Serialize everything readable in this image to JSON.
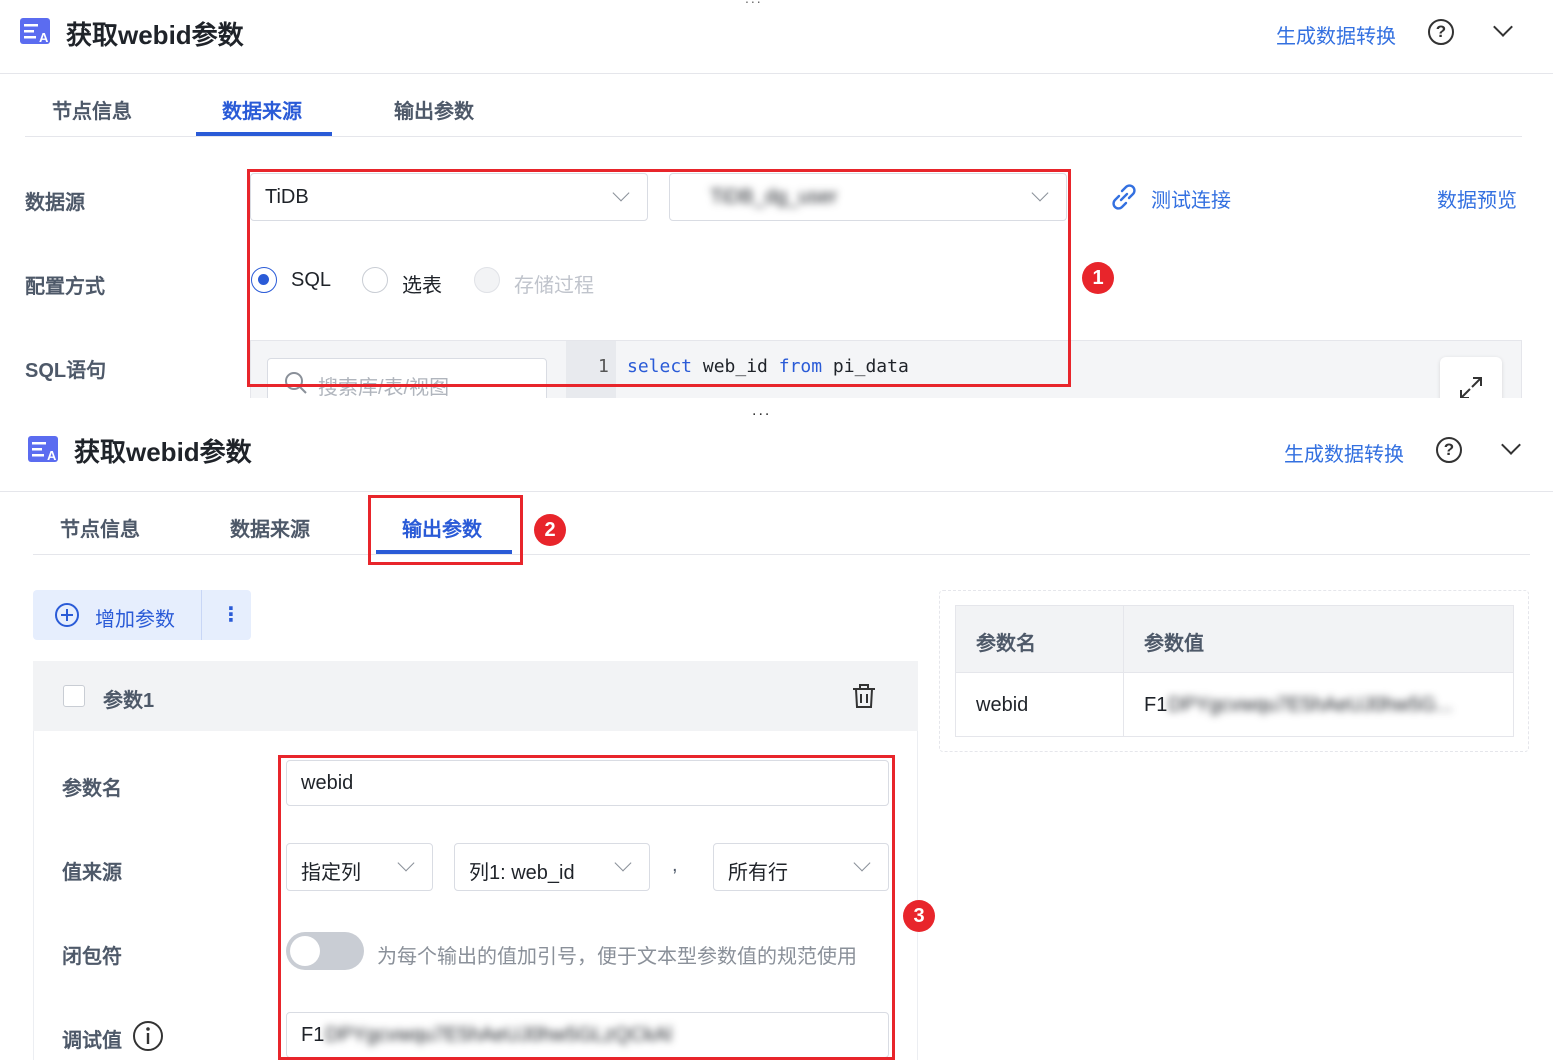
{
  "colors": {
    "accent": "#2a5bd7",
    "link": "#3370e0",
    "annotation": "#e8252b"
  },
  "top_panel": {
    "header": {
      "title": "获取webid参数",
      "generate_link": "生成数据转换",
      "help": "?"
    },
    "tabs": [
      {
        "label": "节点信息",
        "active": false
      },
      {
        "label": "数据来源",
        "active": true
      },
      {
        "label": "输出参数",
        "active": false
      }
    ],
    "datasource": {
      "label": "数据源",
      "db_type": "TiDB",
      "connection": "TiDB_dg_user",
      "test_connection": "测试连接",
      "preview": "数据预览"
    },
    "config": {
      "label": "配置方式",
      "options": [
        "SQL",
        "选表",
        "存储过程"
      ],
      "selected": "SQL"
    },
    "sql": {
      "label": "SQL语句",
      "search_placeholder": "搜索库/表/视图",
      "line_number": "1",
      "kw_select": "select",
      "field": " web_id ",
      "kw_from": "from",
      "table": " pi_data"
    },
    "badge": "1"
  },
  "separator": "...",
  "bottom_panel": {
    "header": {
      "title": "获取webid参数",
      "generate_link": "生成数据转换",
      "help": "?"
    },
    "tabs": [
      {
        "label": "节点信息",
        "active": false
      },
      {
        "label": "数据来源",
        "active": false
      },
      {
        "label": "输出参数",
        "active": true
      }
    ],
    "badge2": "2",
    "badge3": "3",
    "add_param": "增加参数",
    "more": "⋮",
    "param_card": {
      "title": "参数1",
      "name_label": "参数名",
      "name_value": "webid",
      "source_label": "值来源",
      "source_type": "指定列",
      "source_column": "列1: web_id",
      "separator": ",",
      "source_rows": "所有行",
      "enclose_label": "闭包符",
      "enclose_hint": "为每个输出的值加引号，便于文本型参数值的规范使用",
      "debug_label": "调试值",
      "debug_prefix": "F1",
      "debug_blur": "DPYgcvwqu7E5hAeUJ0hw5GLzQCkAl"
    },
    "preview_table": {
      "headers": [
        "参数名",
        "参数值"
      ],
      "row_name": "webid",
      "row_value_prefix": "F1",
      "row_value_blur": "DPYgcvwqu7E5hAeUJ0hw5G..."
    }
  }
}
